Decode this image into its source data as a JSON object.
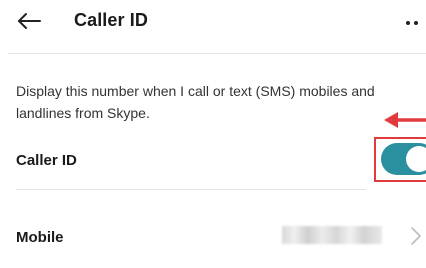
{
  "header": {
    "title": "Caller ID",
    "back_icon": "back-arrow-icon",
    "more_icon": "more-options-icon"
  },
  "description": "Display this number when I call or text (SMS) mobiles and landlines from Skype.",
  "caller_id_row": {
    "label": "Caller ID",
    "toggle_state": "on",
    "toggle_color": "#2a8f9e",
    "annotation_color": "#e23b3b"
  },
  "mobile_row": {
    "label": "Mobile",
    "chevron_icon": "chevron-right-icon"
  }
}
